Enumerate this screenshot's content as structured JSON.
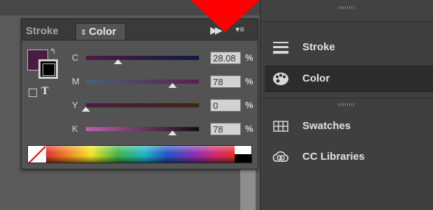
{
  "panel": {
    "tabs": [
      {
        "label": "Stroke"
      },
      {
        "label": "Color"
      }
    ],
    "tab_arrow_glyph": "⇕",
    "swatch": {
      "fill_color": "#4a1c41",
      "stroke_color": "#000000",
      "text_glyph": "T"
    },
    "sliders": [
      {
        "label": "C",
        "value": "28.08",
        "unit": "%",
        "level": 0.28
      },
      {
        "label": "M",
        "value": "78",
        "unit": "%",
        "level": 0.78
      },
      {
        "label": "Y",
        "value": "0",
        "unit": "%",
        "level": 0.0
      },
      {
        "label": "K",
        "value": "78",
        "unit": "%",
        "level": 0.78
      }
    ]
  },
  "dock": {
    "items": [
      {
        "label": "Stroke",
        "icon": "stroke-lines-icon"
      },
      {
        "label": "Color",
        "icon": "palette-icon",
        "active": true
      },
      {
        "label": "Swatches",
        "icon": "swatches-grid-icon"
      },
      {
        "label": "CC Libraries",
        "icon": "cc-libraries-icon"
      }
    ]
  },
  "colors": {
    "accent_arrow": "#ff0000",
    "panel_bg": "#535353",
    "dock_bg": "#3f3f3f"
  }
}
